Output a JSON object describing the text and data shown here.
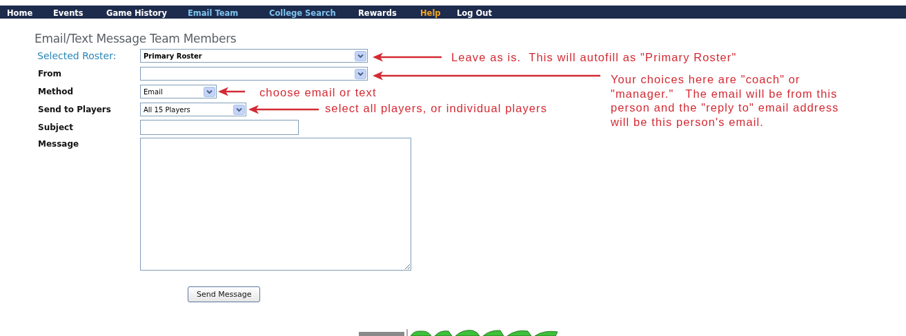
{
  "nav": [
    {
      "label": "Home",
      "color": "#ffffff"
    },
    {
      "label": "Events",
      "color": "#ffffff"
    },
    {
      "label": "Game History",
      "color": "#ffffff"
    },
    {
      "label": "Email Team",
      "color": "#7fc3f0"
    },
    {
      "label": "College Search",
      "color": "#7fc3f0"
    },
    {
      "label": "Rewards",
      "color": "#ffffff"
    },
    {
      "label": "Help",
      "color": "#f5a623"
    },
    {
      "label": "Log Out",
      "color": "#ffffff"
    }
  ],
  "heading": "Email/Text Message Team Members",
  "fields": [
    {
      "label": "Selected Roster:",
      "kind": "select",
      "highlighted": true,
      "value": "Primary Roster",
      "annotation": [
        "Leave as is.  This will autofill as \"Primary Roster\""
      ]
    },
    {
      "label": "From",
      "kind": "select",
      "highlighted": false,
      "annotation": [
        "Your choices here are \"coach\" or",
        "\"manager.\"   The email will be from this",
        "person and the \"reply to\" email address",
        "will be this person's email."
      ]
    },
    {
      "label": "Method",
      "kind": "select",
      "highlighted": false,
      "value": "Email",
      "annotation": [
        "choose email or text"
      ]
    },
    {
      "label": "Send to Players",
      "kind": "select",
      "highlighted": false,
      "value": "All 15 Players",
      "annotation": [
        "select all players, or individual players"
      ]
    },
    {
      "label": "Subject",
      "kind": "text",
      "highlighted": false
    },
    {
      "label": "Message",
      "kind": "textarea",
      "highlighted": false
    }
  ],
  "send_button": "Send Message"
}
